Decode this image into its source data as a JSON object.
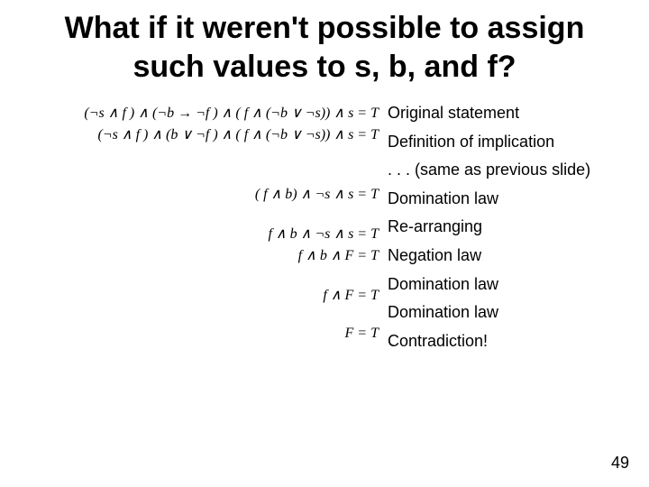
{
  "title": "What if it weren't possible to assign such values to s, b, and f?",
  "equations": {
    "line1": "(¬s ∧ f ) ∧ (¬b → ¬f ) ∧ ( f ∧ (¬b ∨ ¬s)) ∧ s = T",
    "line2": "(¬s ∧ f ) ∧ (b ∨ ¬f ) ∧ ( f ∧ (¬b ∨ ¬s)) ∧ s = T",
    "line3": "",
    "line4": "( f ∧ b) ∧ ¬s ∧ s = T",
    "line5": "f ∧ b ∧ ¬s ∧ s = T",
    "line6": "f ∧ b ∧ F = T",
    "line7": "f ∧ F = T",
    "line8": "F = T"
  },
  "explanations": {
    "e1": "Original statement",
    "e2": "Definition of implication",
    "e3": ". . . (same as previous slide)",
    "e4": "Domination law",
    "e5": "Re-arranging",
    "e6": "Negation law",
    "e7": "Domination law",
    "e8": "Domination law",
    "e9": "Contradiction!"
  },
  "page_number": "49"
}
